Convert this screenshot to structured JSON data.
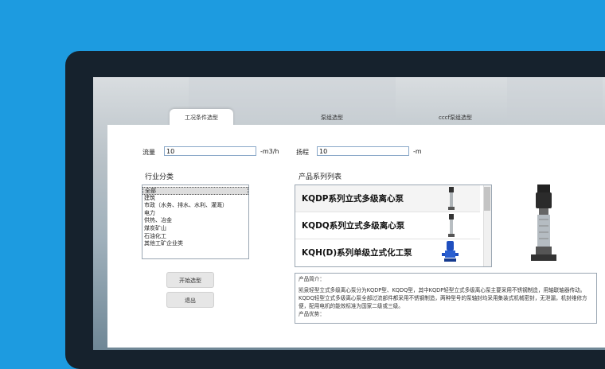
{
  "tabs": [
    "工况条件选型",
    "泵组选型",
    "cccf泵组选型"
  ],
  "form": {
    "flow_label": "流量",
    "flow_value": "10",
    "flow_unit": "-m3/h",
    "head_label": "扬程",
    "head_value": "10",
    "head_unit": "-m"
  },
  "industry": {
    "title": "行业分类",
    "items": [
      "全部",
      "建筑",
      "市政（水务、排水、水利、灌溉）",
      "电力",
      "供热、冶金",
      "煤炭矿山",
      "石油化工",
      "其他工矿企业类"
    ]
  },
  "buttons": {
    "start": "开始选型",
    "exit": "退出"
  },
  "products": {
    "title": "产品系列列表",
    "items": [
      "KQDP系列立式多级离心泵",
      "KQDQ系列立式多级离心泵",
      "KQH(D)系列单级立式化工泵"
    ]
  },
  "description": {
    "heading": "产品简介：",
    "text": "凯泉轻型立式多级离心泵分为KQDP型、KQDQ型，其中KQDP轻型立式多级离心泵主要采用不锈钢制造，用轴联轴器传动。KQDQ轻型立式多级离心泵全部过流部件都采用不锈钢制造，两种型号的泵轴封均采用集装式机械密封，无泄漏，机封维修方便，配用电机的能效标准为国家二级或三级。",
    "more": "产品优势："
  },
  "colors": {
    "desktop": "#1d9be0",
    "monitor": "#16222d",
    "input_border": "#8aa8c8"
  }
}
